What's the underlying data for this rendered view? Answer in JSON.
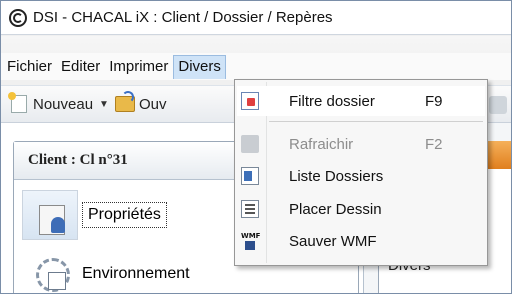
{
  "window": {
    "title": "DSI - CHACAL iX : Client / Dossier / Repères"
  },
  "menubar": {
    "items": [
      "Fichier",
      "Editer",
      "Imprimer",
      "Divers"
    ],
    "active": "Divers"
  },
  "toolbar": {
    "new_label": "Nouveau",
    "open_label": "Ouv"
  },
  "left_panel": {
    "client_title": "Client : Cl n°31",
    "items": [
      {
        "label": "Propriétés",
        "icon": "properties-icon"
      },
      {
        "label": "Environnement",
        "icon": "environment-icon"
      }
    ]
  },
  "right_panel": {
    "label": "Divers"
  },
  "dropdown": {
    "items": [
      {
        "label": "Filtre dossier",
        "shortcut": "F9",
        "icon": "filter-folder-icon",
        "enabled": true
      },
      {
        "label": "Rafraichir",
        "shortcut": "F2",
        "icon": "refresh-icon",
        "enabled": false
      },
      {
        "label": "Liste Dossiers",
        "shortcut": "",
        "icon": "folder-list-icon",
        "enabled": true
      },
      {
        "label": "Placer Dessin",
        "shortcut": "",
        "icon": "place-drawing-icon",
        "enabled": true
      },
      {
        "label": "Sauver WMF",
        "shortcut": "",
        "icon": "save-wmf-icon",
        "enabled": true
      }
    ],
    "wmf_icon_text": "WMF"
  },
  "colors": {
    "menu_highlight": "#cfe3f7",
    "accent_orange": "#e07f1e",
    "disabled_text": "#8d8d8d"
  }
}
